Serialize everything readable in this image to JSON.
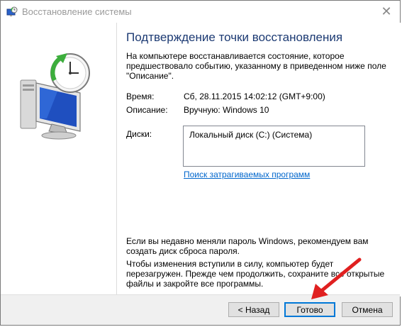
{
  "window": {
    "title": "Восстановление системы",
    "close_glyph": "✕"
  },
  "main": {
    "heading": "Подтверждение точки восстановления",
    "description": "На компьютере восстанавливается состояние, которое предшествовало событию, указанному в приведенном ниже поле \"Описание\".",
    "time_label": "Время:",
    "time_value": "Сб, 28.11.2015 14:02:12 (GMT+9:00)",
    "description_label": "Описание:",
    "description_value": "Вручную: Windows 10",
    "disks_label": "Диски:",
    "disks": [
      "Локальный диск (C:) (Система)"
    ],
    "link_scan": "Поиск затрагиваемых программ",
    "note_password": "Если вы недавно меняли пароль Windows, рекомендуем вам создать диск сброса пароля.",
    "note_restart": "Чтобы изменения вступили в силу, компьютер будет перезагружен. Прежде чем продолжить, сохраните все открытые файлы и закройте все программы."
  },
  "buttons": {
    "back": "< Назад",
    "finish": "Готово",
    "cancel": "Отмена"
  },
  "icons": [
    "system-restore-icon",
    "close-icon",
    "computer-clock-icon",
    "red-arrow-icon"
  ],
  "colors": {
    "heading": "#1c3a73",
    "link": "#0066cc",
    "arrow": "#e02020",
    "footer": "#f0f0f0"
  }
}
